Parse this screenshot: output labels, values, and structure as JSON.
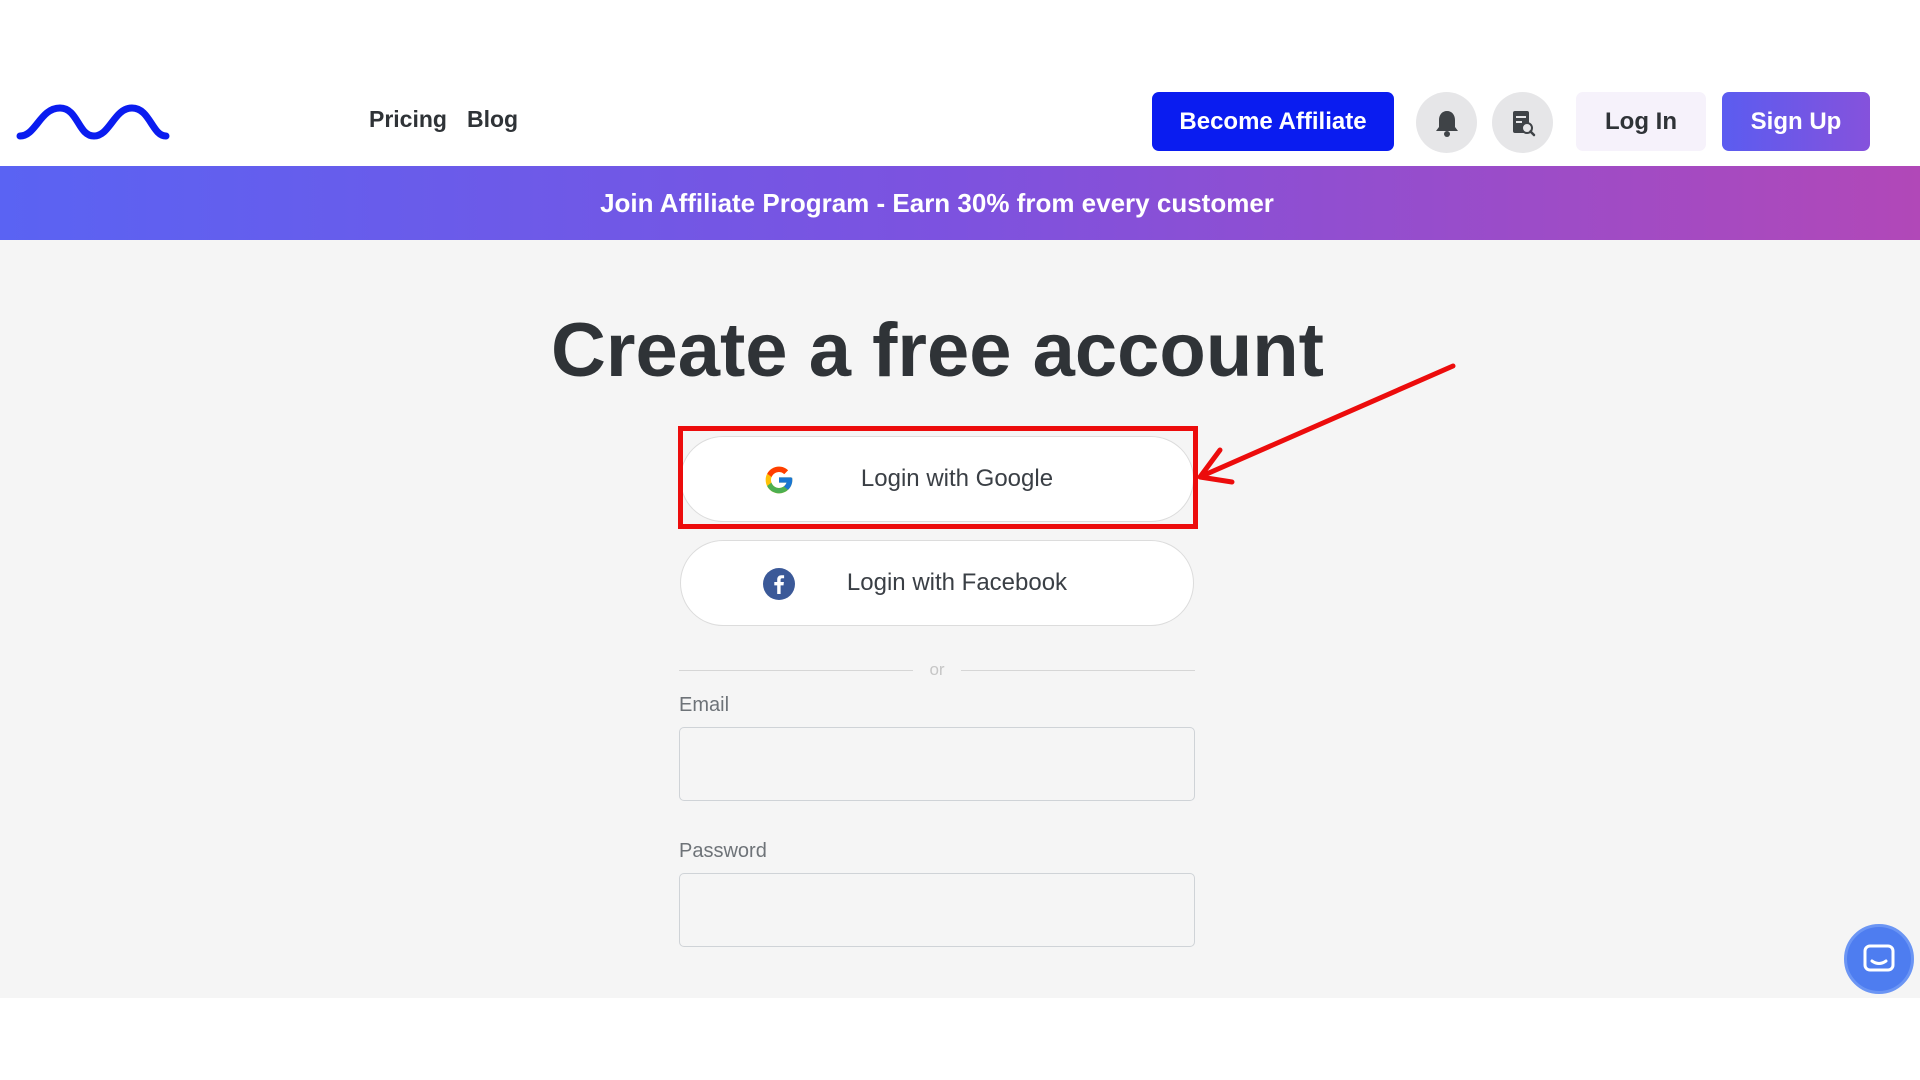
{
  "header": {
    "logo_icon": "wave-logo-icon",
    "nav": [
      {
        "label": "Pricing"
      },
      {
        "label": "Blog"
      }
    ],
    "become_affiliate_label": "Become Affiliate",
    "notification_icon": "bell-icon",
    "document_search_icon": "document-search-icon",
    "login_label": "Log In",
    "signup_label": "Sign Up",
    "colors": {
      "affiliate_button": "#0a1cf0",
      "signup_gradient_start": "#5b5cf0",
      "signup_gradient_end": "#8552dc"
    }
  },
  "banner": {
    "text": "Join Affiliate Program - Earn 30% from every customer"
  },
  "form": {
    "title": "Create a free account",
    "google_label": "Login with Google",
    "google_icon": "google-icon",
    "facebook_label": "Login with Facebook",
    "facebook_icon": "facebook-icon",
    "divider_text": "or",
    "email_label": "Email",
    "email_value": "",
    "password_label": "Password",
    "password_value": ""
  },
  "annotation": {
    "highlight_color": "#ec0c0c"
  },
  "chat": {
    "icon": "chat-icon"
  }
}
